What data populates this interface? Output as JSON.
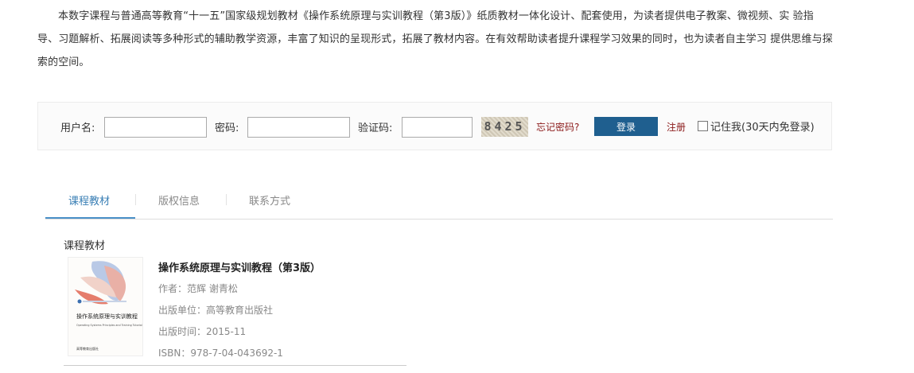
{
  "intro": {
    "paragraph": "本数字课程与普通高等教育“十一五”国家级规划教材《操作系统原理与实训教程（第3版）》纸质教材一体化设计、配套使用，为读者提供电子教案、微视频、实 验指导、习题解析、拓展阅读等多种形式的辅助教学资源，丰富了知识的呈现形式，拓展了教材内容。在有效帮助读者提升课程学习效果的同时，也为读者自主学习 提供思维与探索的空间。"
  },
  "login": {
    "username_label": "用户名:",
    "username_value": "",
    "password_label": "密码:",
    "password_value": "",
    "captcha_label": "验证码:",
    "captcha_value": "",
    "captcha_image_text": "8425",
    "forgot_label": "忘记密码?",
    "login_button": "登录",
    "register_label": "注册",
    "remember_label": "记住我(30天内免登录)"
  },
  "tabs": [
    {
      "label": "课程教材",
      "active": true
    },
    {
      "label": "版权信息",
      "active": false
    },
    {
      "label": "联系方式",
      "active": false
    }
  ],
  "section": {
    "title": "课程教材"
  },
  "book": {
    "title": "操作系统原理与实训教程（第3版）",
    "author": "作者：范辉 谢青松",
    "publisher": "出版单位：高等教育出版社",
    "date": "出版时间：2015-11",
    "isbn": "ISBN：978-7-04-043692-1",
    "cover_title": "操作系统原理与实训教程",
    "cover_subtitle": "Operating Systems Principles and Training Tutorial",
    "cover_publisher": "高等教育出版社"
  },
  "colors": {
    "accent_blue": "#1f5f8f",
    "tab_active": "#3a7fb5",
    "link_red": "#8b1a1a"
  }
}
